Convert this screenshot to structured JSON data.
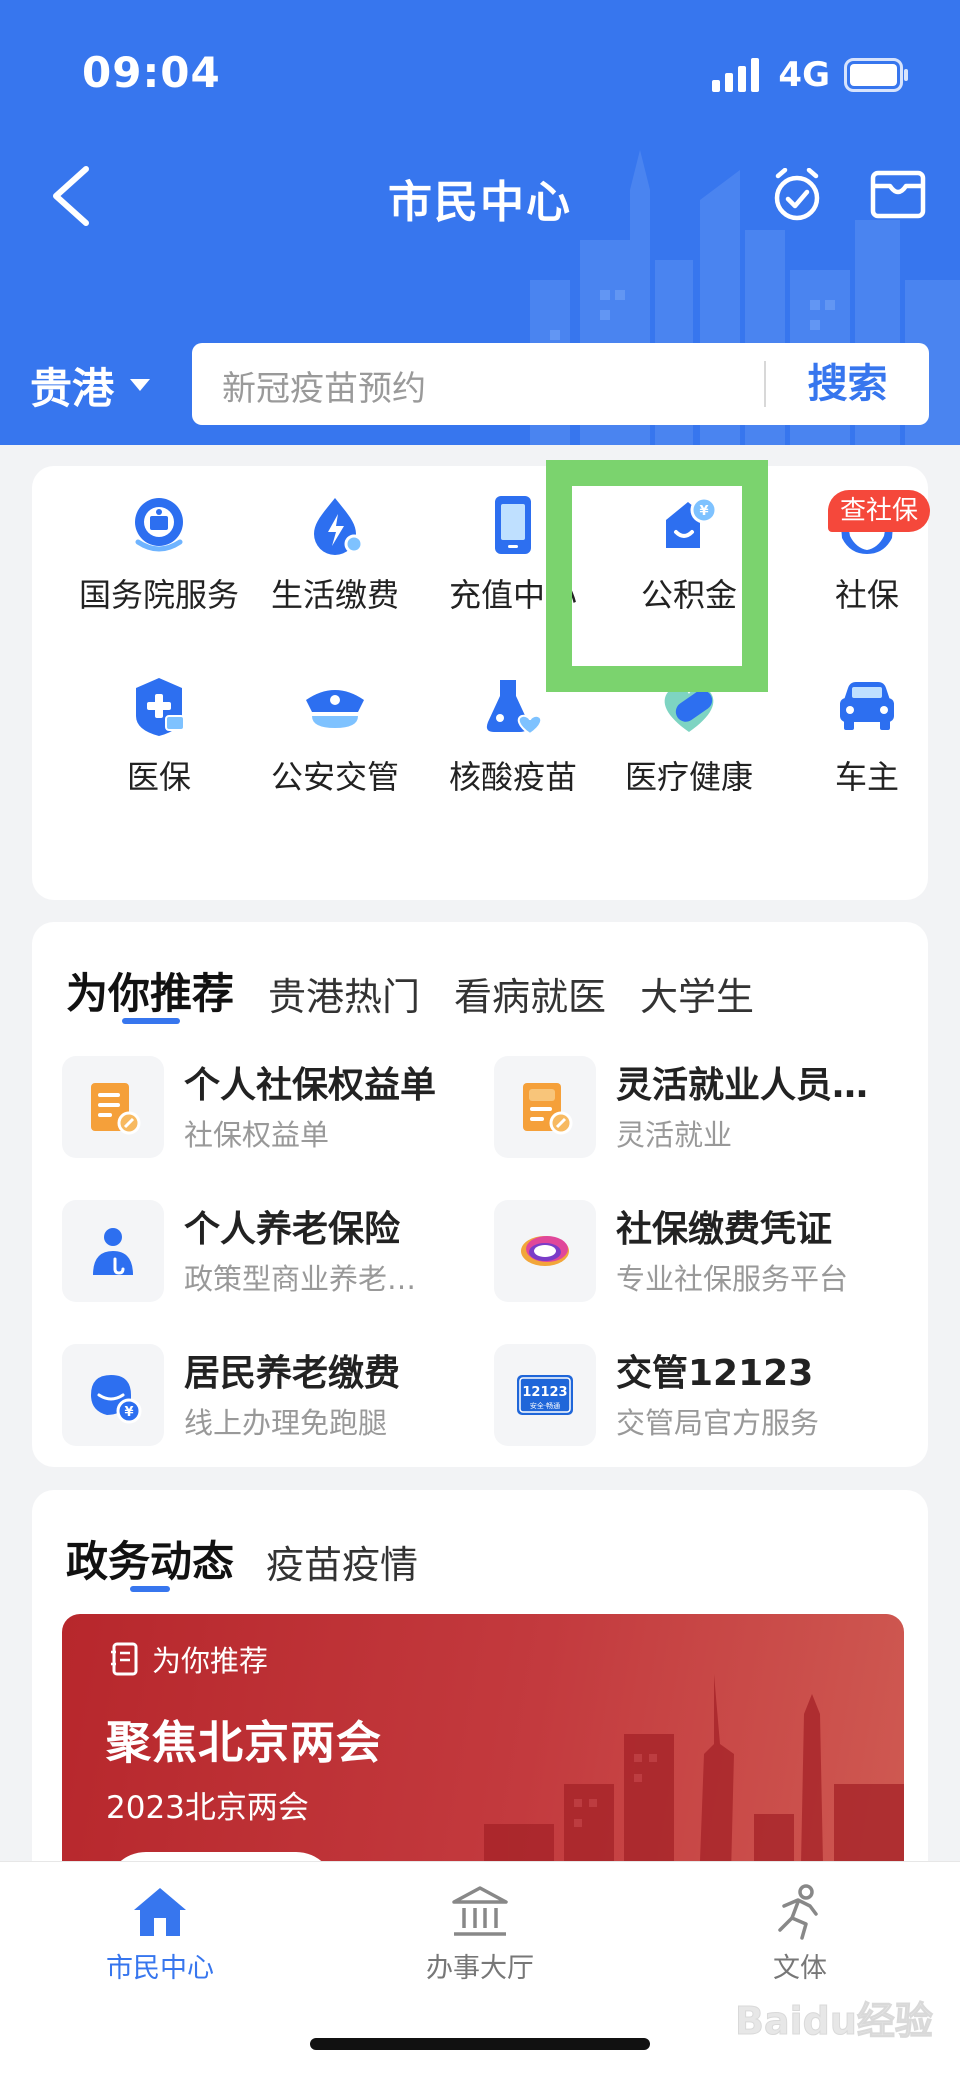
{
  "status_bar": {
    "time": "09:04",
    "network": "4G"
  },
  "nav": {
    "title": "市民中心",
    "back_icon": "chevron-left-icon",
    "alarm_icon": "alarm-clock-check-icon",
    "wallet_icon": "wallet-icon"
  },
  "location": {
    "city": "贵港"
  },
  "search": {
    "placeholder": "新冠疫苗预约",
    "button": "搜索"
  },
  "services": [
    {
      "label": "国务院服务",
      "icon": "state-council-emblem-icon"
    },
    {
      "label": "生活缴费",
      "icon": "water-drop-bolt-icon"
    },
    {
      "label": "充值中心",
      "icon": "phone-icon"
    },
    {
      "label": "公积金",
      "icon": "housing-fund-icon"
    },
    {
      "label": "社保",
      "icon": "hands-heart-icon",
      "badge": "查社保"
    },
    {
      "label": "医保",
      "icon": "medical-shield-icon"
    },
    {
      "label": "公安交管",
      "icon": "police-cap-icon"
    },
    {
      "label": "核酸疫苗",
      "icon": "flask-heart-icon"
    },
    {
      "label": "医疗健康",
      "icon": "heart-pill-icon"
    },
    {
      "label": "车主",
      "icon": "car-icon"
    }
  ],
  "recommend": {
    "tabs": [
      "为你推荐",
      "贵港热门",
      "看病就医",
      "大学生"
    ],
    "items": [
      {
        "title": "个人社保权益单",
        "subtitle": "社保权益单",
        "icon": "document-orange-icon"
      },
      {
        "title": "灵活就业人员…",
        "subtitle": "灵活就业",
        "icon": "briefcase-doc-icon"
      },
      {
        "title": "个人养老保险",
        "subtitle": "政策型商业养老…",
        "icon": "person-umbrella-icon"
      },
      {
        "title": "社保缴费凭证",
        "subtitle": "专业社保服务平台",
        "icon": "colorful-ring-logo-icon"
      },
      {
        "title": "居民养老缴费",
        "subtitle": "线上办理免跑腿",
        "icon": "elder-yuan-icon"
      },
      {
        "title": "交管12123",
        "subtitle": "交管局官方服务",
        "icon": "app-12123-logo-icon",
        "logo_text": "12123",
        "logo_sub": "安全·畅通"
      }
    ]
  },
  "news": {
    "tabs": [
      "政务动态",
      "疫苗疫情"
    ],
    "banner": {
      "tag": "为你推荐",
      "title": "聚焦北京两会",
      "subtitle": "2023北京两会"
    }
  },
  "tabbar": [
    {
      "label": "市民中心",
      "icon": "home-icon",
      "active": true
    },
    {
      "label": "办事大厅",
      "icon": "government-hall-icon",
      "active": false
    },
    {
      "label": "文体",
      "icon": "running-person-icon",
      "active": false
    }
  ],
  "watermark": "Baidu经验",
  "colors": {
    "primary": "#3776ee",
    "highlight": "#7bd36e",
    "badge": "#f5483b",
    "icon_blue": "#2d6ff0",
    "icon_orange": "#f5a03a"
  }
}
